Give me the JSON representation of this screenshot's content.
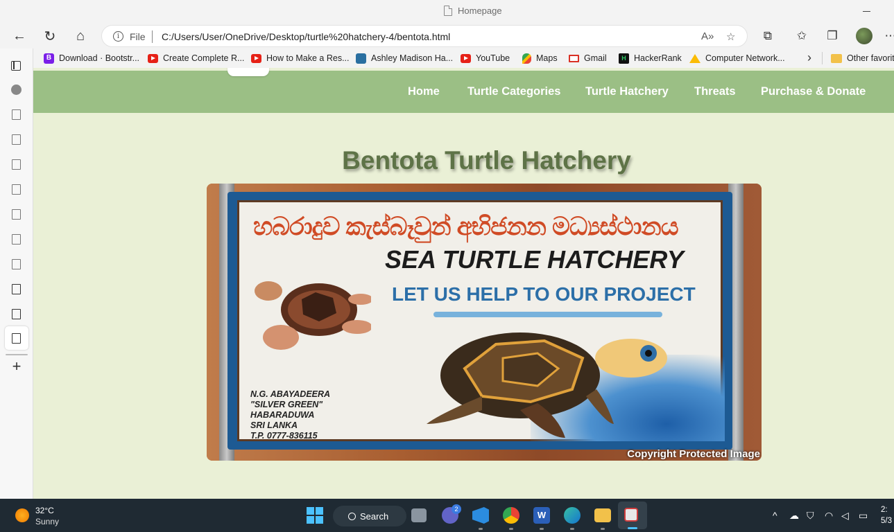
{
  "browser": {
    "tab_title": "Homepage",
    "address": {
      "scheme_label": "File",
      "url": "C:/Users/User/OneDrive/Desktop/turtle%20hatchery-4/bentota.html"
    },
    "bookmarks": [
      {
        "label": "Download · Bootstr...",
        "icon": "bootstrap-icon"
      },
      {
        "label": "Create Complete R...",
        "icon": "youtube-icon"
      },
      {
        "label": "How to Make a Res...",
        "icon": "youtube-icon"
      },
      {
        "label": "Ashley Madison Ha...",
        "icon": "site-icon"
      },
      {
        "label": "YouTube",
        "icon": "youtube-icon"
      },
      {
        "label": "Maps",
        "icon": "maps-icon"
      },
      {
        "label": "Gmail",
        "icon": "gmail-icon"
      },
      {
        "label": "HackerRank",
        "icon": "hackerrank-icon"
      },
      {
        "label": "Computer Network...",
        "icon": "google-drive-icon"
      }
    ],
    "other_favorites": "Other favorit"
  },
  "page": {
    "nav": [
      {
        "label": "Home"
      },
      {
        "label": "Turtle Categories"
      },
      {
        "label": "Turtle Hatchery"
      },
      {
        "label": "Threats"
      },
      {
        "label": "Purchase & Donate"
      }
    ],
    "heading": "Bentota Turtle Hatchery",
    "hero": {
      "sign_sinhala": "හබරාදුව කැස්බෑවුන් අභිජනන මධ්‍යස්ථානය",
      "sign_title": "SEA TURTLE HATCHERY",
      "sign_subtitle": "LET US HELP TO OUR PROJECT",
      "credit_lines": [
        "N.G. ABAYADEERA",
        "\"SILVER GREEN\"",
        "HABARADUWA",
        "SRI LANKA",
        "T.P. 0777-836115"
      ],
      "copyright": "Copyright Protected Image"
    }
  },
  "taskbar": {
    "weather_temp": "32°C",
    "weather_condition": "Sunny",
    "search_label": "Search",
    "teams_badge": "2",
    "clock_time": "2:",
    "clock_date": "5/3"
  },
  "colors": {
    "navbar": "#9bbf85",
    "page_bg": "#eaf0d6",
    "heading": "#5e7347",
    "taskbar": "#1f2a33"
  }
}
